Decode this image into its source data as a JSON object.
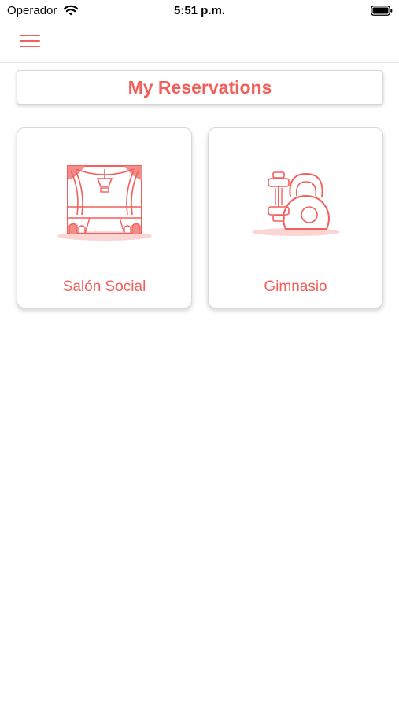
{
  "status_bar": {
    "carrier": "Operador",
    "time": "5:51 p.m."
  },
  "nav": {
    "menu_icon": "hamburger-menu-icon"
  },
  "header": {
    "title": "My Reservations"
  },
  "cards": [
    {
      "label": "Salón Social",
      "icon": "theater-stage-icon"
    },
    {
      "label": "Gimnasio",
      "icon": "dumbbell-kettlebell-icon"
    }
  ],
  "colors": {
    "accent": "#f25f5c",
    "accent_light": "#fbd5d3",
    "background": "#ffffff"
  }
}
